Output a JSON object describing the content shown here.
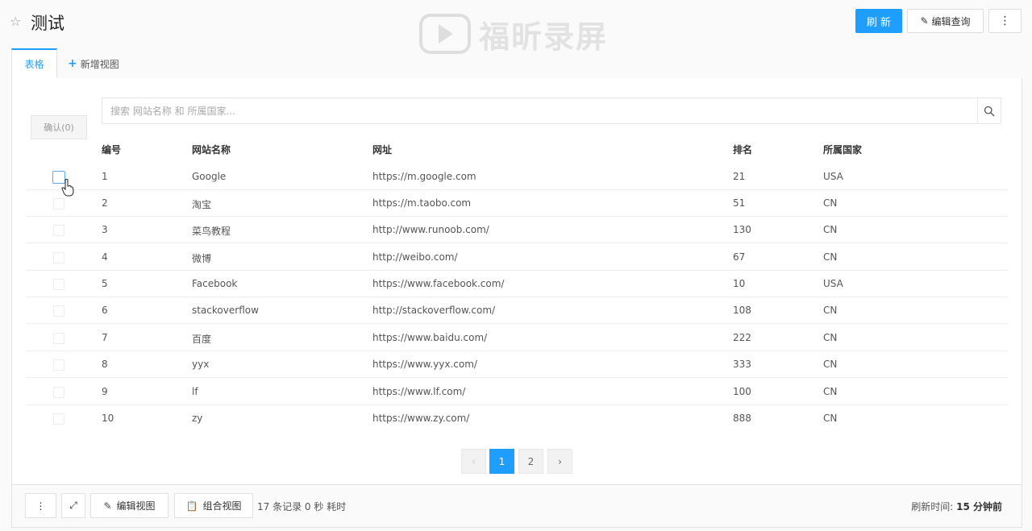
{
  "header": {
    "title": "测试",
    "refresh_label": "刷 新",
    "edit_query_label": "编辑查询",
    "more_label": "⋮"
  },
  "watermark": {
    "text": "福昕录屏"
  },
  "tabs": [
    {
      "label": "表格",
      "active": true
    },
    {
      "label": "新增视图",
      "active": false
    }
  ],
  "toolbar": {
    "confirm_label": "确认(0)",
    "search_placeholder": "搜索 网站名称 和 所属国家..."
  },
  "table": {
    "columns": [
      "编号",
      "网站名称",
      "网址",
      "排名",
      "所属国家"
    ],
    "rows": [
      [
        "1",
        "Google",
        "https://m.google.com",
        "21",
        "USA"
      ],
      [
        "2",
        "淘宝",
        "https://m.taobo.com",
        "51",
        "CN"
      ],
      [
        "3",
        "菜鸟教程",
        "http://www.runoob.com/",
        "130",
        "CN"
      ],
      [
        "4",
        "微博",
        "http://weibo.com/",
        "67",
        "CN"
      ],
      [
        "5",
        "Facebook",
        "https://www.facebook.com/",
        "10",
        "USA"
      ],
      [
        "6",
        "stackoverflow",
        "http://stackoverflow.com/",
        "108",
        "CN"
      ],
      [
        "7",
        "百度",
        "https://www.baidu.com/",
        "222",
        "CN"
      ],
      [
        "8",
        "yyx",
        "https://www.yyx.com/",
        "333",
        "CN"
      ],
      [
        "9",
        "lf",
        "https://www.lf.com/",
        "100",
        "CN"
      ],
      [
        "10",
        "zy",
        "https://www.zy.com/",
        "888",
        "CN"
      ]
    ]
  },
  "pagination": {
    "prev": "‹",
    "pages": [
      "1",
      "2"
    ],
    "current": "1",
    "next": "›"
  },
  "footer": {
    "more_label": "⋮",
    "expand_label": "⤢",
    "edit_view_label": "编辑视图",
    "combine_view_label": "组合视图",
    "records_text": "17 条记录 0 秒 耗时",
    "refresh_prefix": "刷新时间:",
    "refresh_value": "15 分钟前"
  },
  "colors": {
    "primary": "#1e9fff"
  }
}
